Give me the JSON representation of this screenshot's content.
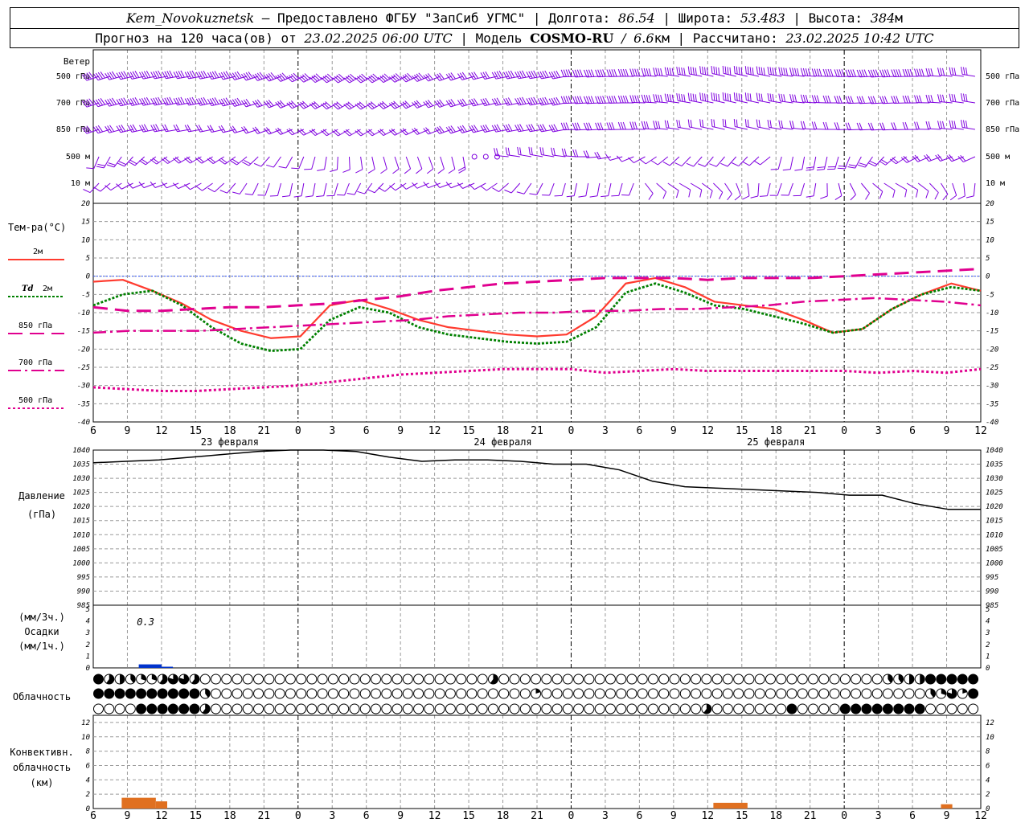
{
  "header": {
    "station": "Kem_Novokuznetsk",
    "provider": "Предоставлено ФГБУ \"ЗапСиб УГМС\"",
    "lon_label": "Долгота:",
    "lon": "86.54",
    "lat_label": "Широта:",
    "lat": "53.483",
    "alt_label": "Высота:",
    "alt": "384",
    "alt_unit": "м",
    "forecast_label": "Прогноз на 120 часа(ов)  от",
    "forecast_start": "23.02.2025 06:00 UTC",
    "model_label": "Модель",
    "model": "COSMO-RU",
    "model_res": "6.6",
    "model_res_unit": "км",
    "calc_label": "Рассчитано:",
    "calc_time": "23.02.2025 10:42 UTC",
    "sep": "|",
    "dash": "—",
    "slash": "/"
  },
  "time_axis": {
    "hour_labels": [
      "6",
      "9",
      "12",
      "15",
      "18",
      "21",
      "0",
      "3",
      "6",
      "9",
      "12",
      "15",
      "18",
      "21",
      "0",
      "3",
      "6",
      "9",
      "12",
      "15",
      "18",
      "21",
      "0",
      "3",
      "6",
      "9",
      "12"
    ],
    "date_labels": [
      "23 февраля",
      "24 февраля",
      "25 февраля"
    ],
    "date_hours": [
      12,
      36,
      60
    ]
  },
  "wind_panel": {
    "title": "Ветер",
    "levels": [
      "500 гПа",
      "700 гПа",
      "850 гПа",
      "500 м",
      "10  м"
    ],
    "color": "#7f00df"
  },
  "chart_data": [
    {
      "type": "line",
      "name": "temperature",
      "title": "Тем-ра(°C)",
      "x_hours": [
        0,
        3,
        6,
        9,
        12,
        15,
        18,
        21,
        24,
        27,
        30,
        33,
        36,
        39,
        42,
        45,
        48,
        51,
        54,
        57,
        60,
        63,
        66,
        69,
        72,
        75,
        78
      ],
      "ylim": [
        -40,
        20
      ],
      "yticks": [
        -40,
        -35,
        -30,
        -25,
        -20,
        -15,
        -10,
        -5,
        0,
        5,
        10,
        15,
        20
      ],
      "series": [
        {
          "name": "2м",
          "color": "#ff3b2f",
          "style": "solid",
          "values": [
            -1.5,
            -1,
            -4,
            -7.5,
            -12,
            -15,
            -17,
            -16.5,
            -8,
            -6.5,
            -9,
            -12,
            -14,
            -15,
            -16,
            -16.5,
            -16,
            -11,
            -2,
            -0.5,
            -3,
            -7,
            -8,
            -9,
            -12,
            -15.5,
            -14.5,
            -9,
            -5,
            -2,
            -4
          ]
        },
        {
          "name": "Td  2м",
          "color": "#008000",
          "style": "dotted",
          "values": [
            -8,
            -5,
            -4,
            -8,
            -14,
            -18.5,
            -20.5,
            -20,
            -12,
            -8.5,
            -10,
            -14,
            -16,
            -17,
            -18,
            -18.5,
            -18,
            -14,
            -4.5,
            -2,
            -4.5,
            -8,
            -9,
            -11,
            -13,
            -15.5,
            -14.5,
            -9,
            -5,
            -3,
            -4
          ]
        },
        {
          "name": "850 гПа",
          "color": "#e0008f",
          "style": "dashed",
          "values": [
            -8.5,
            -9.5,
            -9.5,
            -9,
            -8.5,
            -8.5,
            -8,
            -7.5,
            -6.5,
            -5.5,
            -4,
            -3,
            -2,
            -1.5,
            -1,
            -0.5,
            -0.5,
            -0.5,
            -1,
            -0.5,
            -0.5,
            -0.5,
            0,
            0.5,
            1,
            1.5,
            2
          ]
        },
        {
          "name": "700 гПа",
          "color": "#e0008f",
          "style": "dashdot",
          "values": [
            -15.5,
            -15,
            -15,
            -15,
            -14.5,
            -14,
            -13.5,
            -13,
            -12.5,
            -12,
            -11,
            -10.5,
            -10,
            -10,
            -9.5,
            -9.5,
            -9,
            -9,
            -8.5,
            -8,
            -7,
            -6.5,
            -6,
            -6.5,
            -7,
            -8
          ]
        },
        {
          "name": "500 гПа",
          "color": "#e0008f",
          "style": "dotted-thick",
          "values": [
            -30.5,
            -31,
            -31.5,
            -31.5,
            -31,
            -30.5,
            -30,
            -29,
            -28,
            -27,
            -26.5,
            -26,
            -25.5,
            -25.5,
            -25.5,
            -26.5,
            -26,
            -25.5,
            -26,
            -26,
            -26,
            -26,
            -26,
            -26.5,
            -26,
            -26.5,
            -25.5
          ]
        }
      ]
    },
    {
      "type": "line",
      "name": "pressure",
      "title": "Давление",
      "unit": "(гПа)",
      "x_hours": [
        0,
        3,
        6,
        9,
        12,
        15,
        18,
        21,
        24,
        27,
        30,
        33,
        36,
        39,
        42,
        45,
        48,
        51,
        54,
        57,
        60,
        63,
        66,
        69,
        72,
        75,
        78
      ],
      "ylim": [
        985,
        1040
      ],
      "yticks": [
        985,
        990,
        995,
        1000,
        1005,
        1010,
        1015,
        1020,
        1025,
        1030,
        1035,
        1040
      ],
      "series": [
        {
          "name": "",
          "color": "#000000",
          "style": "solid",
          "values": [
            1035.5,
            1036,
            1036.5,
            1037.5,
            1038.5,
            1039.5,
            1040,
            1040,
            1039.5,
            1037.5,
            1036,
            1036.5,
            1036.5,
            1036,
            1035,
            1035,
            1033,
            1029,
            1027,
            1026.5,
            1026,
            1025.5,
            1025,
            1024,
            1024,
            1021,
            1019,
            1019
          ]
        }
      ]
    },
    {
      "type": "bar",
      "name": "precipitation",
      "title": "Осадки",
      "unit_top": "(мм/3ч.)",
      "unit_bottom": "(мм/1ч.)",
      "ylim": [
        0,
        5
      ],
      "yticks": [
        0,
        1,
        2,
        3,
        4,
        5
      ],
      "annotation": "0.3",
      "bars": [
        {
          "start": 4,
          "end": 6,
          "value": 0.3,
          "color": "#0033cc"
        },
        {
          "start": 6,
          "end": 7,
          "value": 0.1,
          "color": "#0033cc"
        }
      ]
    },
    {
      "type": "bar",
      "name": "convective_cloud",
      "title_lines": [
        "Конвективн.",
        "облачность",
        "(км)"
      ],
      "ylim": [
        0,
        13
      ],
      "yticks": [
        0,
        2,
        4,
        6,
        8,
        10,
        12
      ],
      "bars": [
        {
          "start": 2.5,
          "end": 5.5,
          "value": 1.5,
          "color": "#e07020"
        },
        {
          "start": 5.5,
          "end": 6.5,
          "value": 1.0,
          "color": "#e07020"
        },
        {
          "start": 54.5,
          "end": 57.5,
          "value": 0.8,
          "color": "#e07020"
        },
        {
          "start": 74.5,
          "end": 75.5,
          "value": 0.6,
          "color": "#e07020"
        }
      ]
    }
  ],
  "cloud_panel": {
    "title": "Облачность",
    "rows": [
      [
        1,
        0.6,
        0.5,
        0.4,
        0.3,
        0.3,
        0.6,
        0.8,
        0.8,
        0.6,
        0,
        0,
        0,
        0,
        0,
        0,
        0,
        0,
        0,
        0,
        0,
        0,
        0,
        0,
        0,
        0,
        0,
        0,
        0,
        0,
        0,
        0,
        0,
        0,
        0,
        0,
        0,
        0.6,
        0,
        0,
        0,
        0,
        0,
        0,
        0,
        0,
        0,
        0,
        0,
        0,
        0,
        0,
        0,
        0,
        0,
        0,
        0,
        0,
        0,
        0,
        0,
        0,
        0,
        0,
        0,
        0,
        0,
        0,
        0,
        0,
        0,
        0,
        0,
        0,
        0.4,
        0.4,
        0.5,
        0.5,
        1,
        1,
        1,
        1,
        1,
        0.7,
        0
      ],
      [
        1,
        1,
        1,
        1,
        1,
        1,
        1,
        1,
        1,
        1,
        0.4,
        0,
        0,
        0,
        0,
        0,
        0,
        0,
        0,
        0,
        0,
        0,
        0,
        0,
        0,
        0,
        0,
        0,
        0,
        0,
        0,
        0,
        0,
        0,
        0,
        0,
        0,
        0,
        0,
        0,
        0,
        0.2,
        0,
        0,
        0,
        0,
        0,
        0,
        0,
        0,
        0,
        0,
        0,
        0,
        0,
        0,
        0,
        0,
        0,
        0,
        0,
        0,
        0,
        0,
        0,
        0,
        0,
        0,
        0,
        0,
        0,
        0,
        0,
        0,
        0,
        0,
        0,
        0,
        0.4,
        0.3,
        0.8,
        0.2,
        1,
        1,
        1,
        0.7,
        0.8
      ],
      [
        0,
        0,
        0,
        0,
        1,
        1,
        1,
        1,
        1,
        1,
        0.6,
        0,
        0,
        0,
        0,
        0,
        0,
        0,
        0,
        0,
        0,
        0,
        0,
        0,
        0,
        0,
        0,
        0,
        0,
        0,
        0,
        0,
        0,
        0,
        0,
        0,
        0,
        0,
        0,
        0,
        0,
        0,
        0,
        0,
        0,
        0,
        0,
        0,
        0,
        0,
        0,
        0,
        0,
        0,
        0,
        0,
        0,
        0.6,
        0,
        0,
        0,
        0,
        0,
        0,
        0,
        1,
        0,
        0,
        0,
        0,
        1,
        1,
        1,
        1,
        1,
        1,
        1,
        1,
        0,
        0,
        0,
        0,
        0
      ]
    ]
  },
  "legend": {
    "t2m": "2м",
    "td_prefix": "Td",
    "td": "2м",
    "p850": "850 гПа",
    "p700": "700 гПа",
    "p500": "500 гПа"
  }
}
